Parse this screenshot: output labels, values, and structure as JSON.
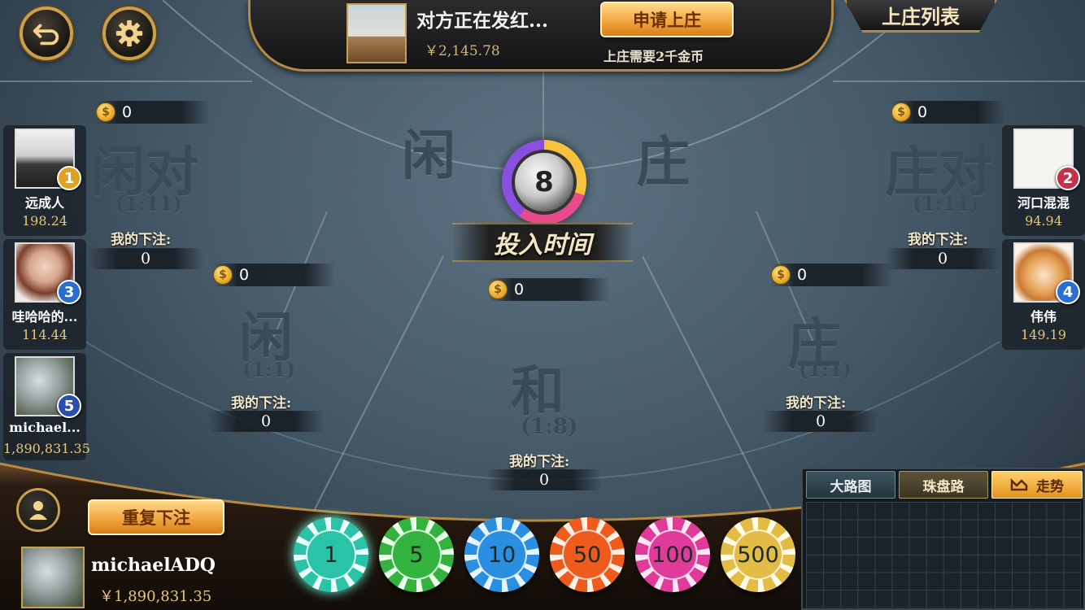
{
  "top_buttons": {
    "back": "back-arrow",
    "settings": "gear"
  },
  "banker": {
    "name": "对方正在发红...",
    "money": "￥2,145.78",
    "apply_label": "申请上庄",
    "apply_note": "上庄需要2千金币",
    "list_label": "上庄列表"
  },
  "timer": {
    "seconds": "8",
    "phase_label": "投入时间"
  },
  "zones": {
    "player_pair": {
      "name": "闲对",
      "odds": "(1:11)",
      "pool": "0",
      "my_bet_label": "我的下注:",
      "my_bet": "0"
    },
    "banker_pair": {
      "name": "庄对",
      "odds": "(1:11)",
      "pool": "0",
      "my_bet_label": "我的下注:",
      "my_bet": "0"
    },
    "player": {
      "name": "闲",
      "odds": "(1:1)",
      "pool": "0",
      "my_bet_label": "我的下注:",
      "my_bet": "0"
    },
    "banker": {
      "name": "庄",
      "odds": "(1:1)",
      "pool": "0",
      "my_bet_label": "我的下注:",
      "my_bet": "0"
    },
    "tie": {
      "name": "和",
      "odds": "(1:8)",
      "pool": "0",
      "my_bet_label": "我的下注:",
      "my_bet": "0"
    },
    "top_left_label": "闲",
    "top_right_label": "庄"
  },
  "players_left": [
    {
      "name": "远成人",
      "money": "198.24",
      "rank": "1",
      "rank_color": "#e0a21e"
    },
    {
      "name": "哇哈哈的...",
      "money": "114.44",
      "rank": "3",
      "rank_color": "#2a6fd0"
    },
    {
      "name": "michael...",
      "money": "1,890,831.35",
      "rank": "5",
      "rank_color": "#2a4fb0"
    }
  ],
  "players_right": [
    {
      "name": "河口混混",
      "money": "94.94",
      "rank": "2",
      "rank_color": "#c8304a"
    },
    {
      "name": "伟伟",
      "money": "149.19",
      "rank": "4",
      "rank_color": "#2a6fd0"
    }
  ],
  "me": {
    "name": "michaelADQ",
    "money": "￥1,890,831.35",
    "rebet_label": "重复下注"
  },
  "chips": [
    {
      "value": "1",
      "color": "#2bc3a8"
    },
    {
      "value": "5",
      "color": "#33b23d"
    },
    {
      "value": "10",
      "color": "#2a8fe0"
    },
    {
      "value": "50",
      "color": "#ef5b1c"
    },
    {
      "value": "100",
      "color": "#e03b9a"
    },
    {
      "value": "500",
      "color": "#e2bc45"
    }
  ],
  "roadmap": {
    "tab_big_road": "大路图",
    "tab_bead_road": "珠盘路",
    "tab_trend": "走势"
  }
}
